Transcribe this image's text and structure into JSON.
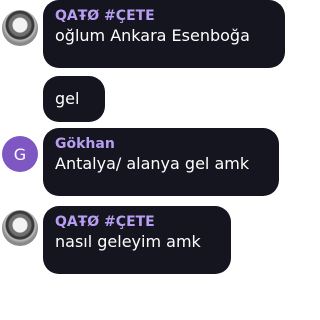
{
  "messages": [
    {
      "sender": "QAŦØ #ÇETE",
      "text": "oğlum Ankara Esenboğa",
      "avatar": "photo"
    },
    {
      "sender": "",
      "text": "gel",
      "avatar": ""
    },
    {
      "sender": "Gökhan",
      "text": "Antalya/ alanya gel amk",
      "avatar": "G"
    },
    {
      "sender": "QAŦØ #ÇETE",
      "text": "nasıl geleyim amk",
      "avatar": "photo"
    }
  ],
  "colors": {
    "bubble": "#151520",
    "sender": "#b89ef2",
    "avatar_letter_bg": "#7e57c2"
  }
}
